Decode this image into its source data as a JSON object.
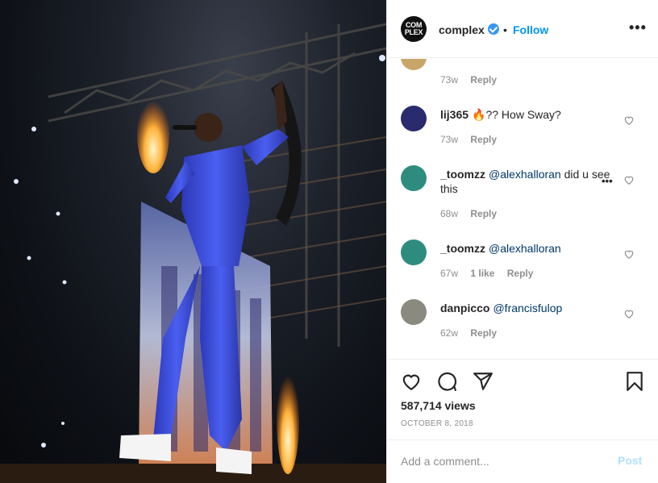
{
  "post": {
    "account": "complex",
    "avatar_text": [
      "COM",
      "PLEX"
    ],
    "follow_label": "Follow",
    "separator": "•",
    "more_label": "•••"
  },
  "comments": [
    {
      "user": "",
      "text": "",
      "mention": "",
      "age": "73w",
      "likes": "",
      "reply": "Reply",
      "avatar_color": "#caa56a"
    },
    {
      "user": "lij365",
      "text": "🔥?? How Sway?",
      "mention": "",
      "age": "73w",
      "likes": "",
      "reply": "Reply",
      "avatar_color": "#2a2a6e"
    },
    {
      "user": "_toomzz",
      "text": " did u see this",
      "mention": "@alexhalloran",
      "age": "68w",
      "likes": "",
      "reply": "Reply",
      "avatar_color": "#2e8c7e"
    },
    {
      "user": "_toomzz",
      "text": "",
      "mention": "@alexhalloran",
      "age": "67w",
      "likes": "1 like",
      "reply": "Reply",
      "avatar_color": "#2e8c7e"
    },
    {
      "user": "danpicco",
      "text": "",
      "mention": "@francisfulop",
      "age": "62w",
      "likes": "",
      "reply": "Reply",
      "avatar_color": "#8a8a80"
    }
  ],
  "inline_more": "•••",
  "stats": {
    "views": "587,714 views",
    "date": "OCTOBER 8, 2018"
  },
  "composer": {
    "placeholder": "Add a comment...",
    "post_label": "Post"
  },
  "colors": {
    "link": "#0095f6",
    "mention": "#00376b",
    "muted": "#8e8e8e",
    "suit": "#3a4fd8",
    "flame": "#ff8a1a"
  },
  "icons": {
    "like": "heart-icon",
    "comment": "comment-icon",
    "share": "paper-plane-icon",
    "save": "bookmark-icon",
    "comment_like": "small-heart-icon",
    "verified": "verified-badge-icon"
  }
}
